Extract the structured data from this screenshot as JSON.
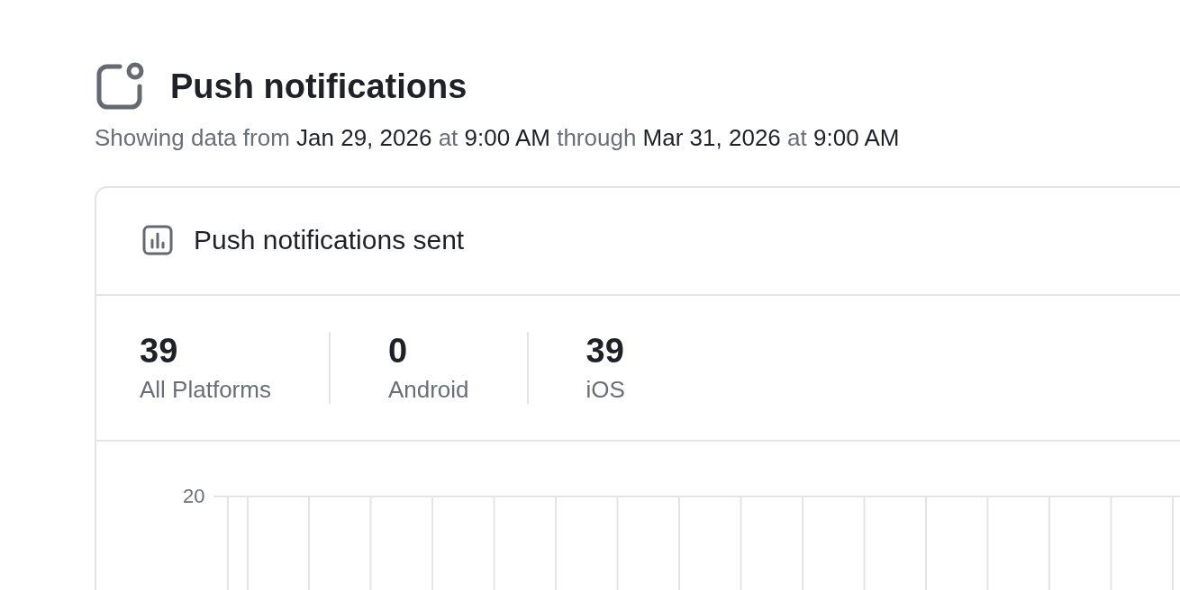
{
  "page": {
    "title": "Push notifications",
    "subtitle": [
      {
        "text": "Showing data from",
        "kind": "muted"
      },
      {
        "text": "Jan 29, 2026",
        "kind": "value"
      },
      {
        "text": "at",
        "kind": "muted"
      },
      {
        "text": "9:00 AM",
        "kind": "value"
      },
      {
        "text": "through",
        "kind": "muted"
      },
      {
        "text": "Mar 31, 2026",
        "kind": "value"
      },
      {
        "text": "at",
        "kind": "muted"
      },
      {
        "text": "9:00 AM",
        "kind": "value"
      }
    ]
  },
  "card": {
    "title": "Push notifications sent",
    "stats": [
      {
        "value": "39",
        "label": "All Platforms"
      },
      {
        "value": "0",
        "label": "Android"
      },
      {
        "value": "39",
        "label": "iOS"
      }
    ],
    "chart": {
      "y_tick": "20"
    }
  }
}
